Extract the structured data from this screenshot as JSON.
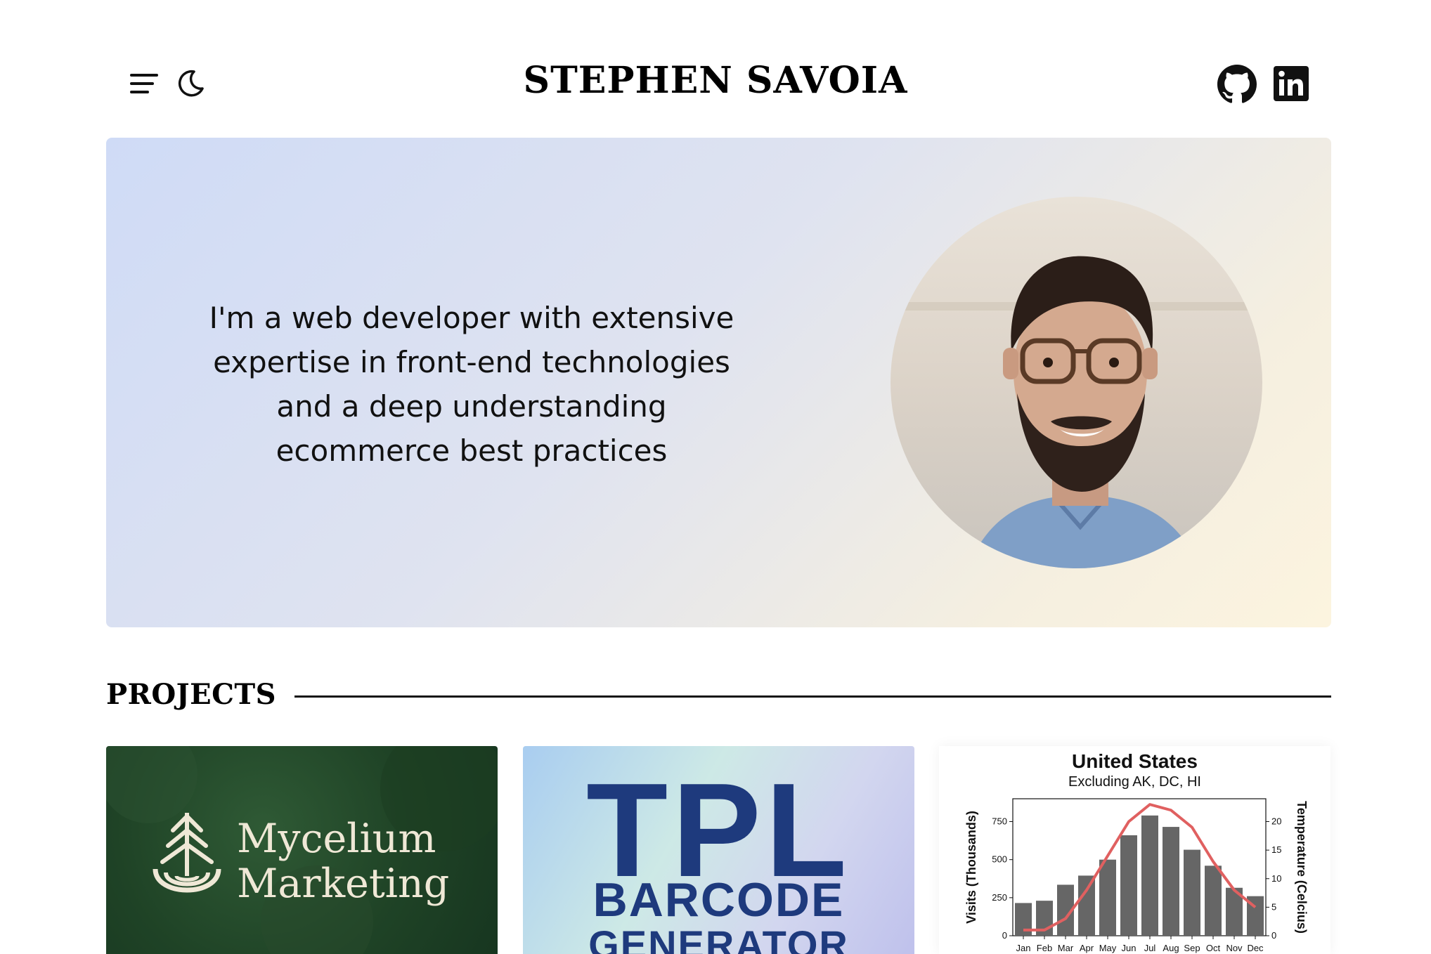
{
  "header": {
    "title": "STEPHEN SAVOIA",
    "menu_icon": "hamburger-menu-icon",
    "theme_icon": "moon-icon",
    "social": [
      {
        "name": "GitHub",
        "icon": "github-icon"
      },
      {
        "name": "LinkedIn",
        "icon": "linkedin-icon"
      }
    ]
  },
  "hero": {
    "bio_lines": [
      "I'm a web developer with extensive",
      "expertise in front-end technologies",
      "and a deep understanding",
      "ecommerce best practices"
    ],
    "colors": {
      "gradient_start": "#cfdbf6",
      "gradient_end": "#fcf4df"
    }
  },
  "projects": {
    "heading": "PROJECTS",
    "cards": [
      {
        "logo_line1": "Mycelium",
        "logo_line2": "Marketing",
        "icon": "pine-tree-logo-icon"
      },
      {
        "line1": "TPL",
        "line2": "BARCODE",
        "line3": "GENERATOR"
      },
      {
        "chart_preview": true
      }
    ]
  },
  "chart_data": {
    "type": "bar",
    "title": "United States",
    "subtitle": "Excluding AK, DC, HI",
    "ylabel": "Visits (Thousands)",
    "y2label": "Temperature (Celcius)",
    "categories": [
      "Jan",
      "Feb",
      "Mar",
      "Apr",
      "May",
      "Jun",
      "Jul",
      "Aug",
      "Sep",
      "Oct",
      "Nov",
      "Dec"
    ],
    "ylim": [
      0,
      900
    ],
    "y2lim": [
      0,
      24
    ],
    "yticks": [
      0,
      250,
      500,
      750
    ],
    "y2ticks": [
      0,
      5,
      10,
      15,
      20
    ],
    "series": [
      {
        "values": [
          215,
          230,
          335,
          395,
          500,
          660,
          790,
          715,
          565,
          460,
          315,
          260
        ],
        "color": "#666666"
      },
      {
        "values": [
          1,
          1,
          3,
          8,
          14,
          20,
          23,
          22,
          19,
          13,
          8,
          5
        ],
        "color": "#e06060"
      }
    ]
  }
}
